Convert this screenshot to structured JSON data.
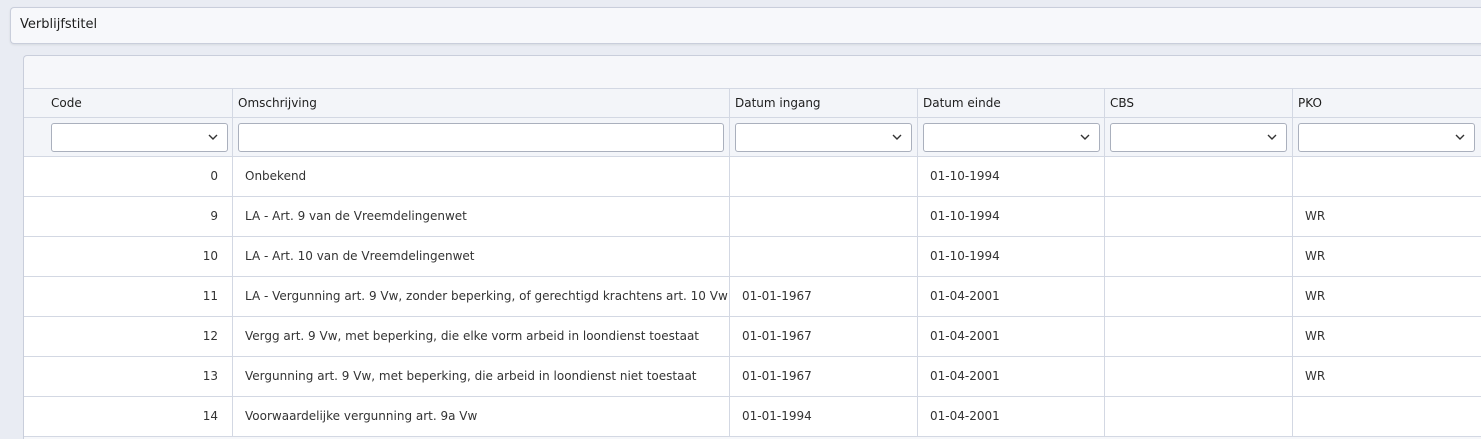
{
  "window": {
    "title": "Verblijfstitel"
  },
  "table": {
    "columns": [
      {
        "label": "Code"
      },
      {
        "label": "Omschrijving"
      },
      {
        "label": "Datum ingang"
      },
      {
        "label": "Datum einde"
      },
      {
        "label": "CBS"
      },
      {
        "label": "PKO"
      }
    ],
    "filters": {
      "code": "",
      "omschrijving": "",
      "datum_ingang": "",
      "datum_einde": "",
      "cbs": "",
      "pko": ""
    },
    "rows": [
      {
        "code": "0",
        "omschrijving": "Onbekend",
        "datum_ingang": "",
        "datum_einde": "01-10-1994",
        "cbs": "",
        "pko": ""
      },
      {
        "code": "9",
        "omschrijving": "LA - Art. 9 van de Vreemdelingenwet",
        "datum_ingang": "",
        "datum_einde": "01-10-1994",
        "cbs": "",
        "pko": "WR"
      },
      {
        "code": "10",
        "omschrijving": "LA - Art. 10 van de Vreemdelingenwet",
        "datum_ingang": "",
        "datum_einde": "01-10-1994",
        "cbs": "",
        "pko": "WR"
      },
      {
        "code": "11",
        "omschrijving": "LA - Vergunning art. 9 Vw, zonder beperking, of gerechtigd krachtens art. 10 Vw",
        "datum_ingang": "01-01-1967",
        "datum_einde": "01-04-2001",
        "cbs": "",
        "pko": "WR"
      },
      {
        "code": "12",
        "omschrijving": "Vergg art. 9 Vw, met beperking, die elke vorm arbeid in loondienst toestaat",
        "datum_ingang": "01-01-1967",
        "datum_einde": "01-04-2001",
        "cbs": "",
        "pko": "WR"
      },
      {
        "code": "13",
        "omschrijving": "Vergunning art. 9 Vw, met beperking, die arbeid in loondienst niet toestaat",
        "datum_ingang": "01-01-1967",
        "datum_einde": "01-04-2001",
        "cbs": "",
        "pko": "WR"
      },
      {
        "code": "14",
        "omschrijving": "Voorwaardelijke vergunning art. 9a Vw",
        "datum_ingang": "01-01-1994",
        "datum_einde": "01-04-2001",
        "cbs": "",
        "pko": ""
      }
    ]
  },
  "icons": {
    "dropdown": "chevron-down-icon"
  }
}
